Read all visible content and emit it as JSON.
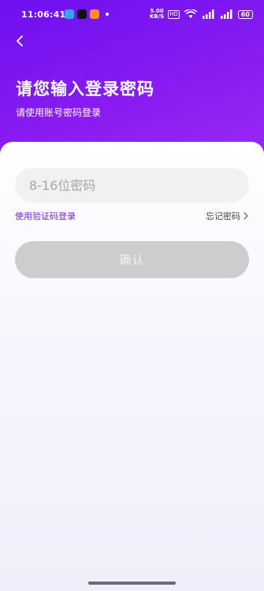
{
  "status_bar": {
    "time": "11:06:41",
    "net_speed_value": "5.00",
    "net_speed_unit": "KB/S",
    "hd_label": "HD",
    "battery": "60"
  },
  "header": {
    "title": "请您输入登录密码",
    "subtitle": "请使用账号密码登录"
  },
  "form": {
    "password_placeholder": "8-16位密码",
    "password_value": "",
    "sms_login_label": "使用验证码登录",
    "forgot_password_label": "忘记密码",
    "confirm_label": "确认"
  },
  "colors": {
    "header_gradient_start": "#6d10f0",
    "header_gradient_end": "#9b2cf4",
    "link_purple": "#7a1ee6",
    "disabled_button": "#cdcdd0"
  }
}
